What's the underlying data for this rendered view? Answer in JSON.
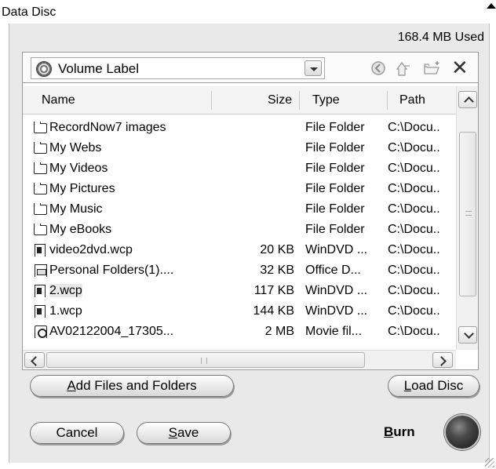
{
  "window": {
    "title": "Data Disc"
  },
  "disc": {
    "used": "168.4 MB Used"
  },
  "volume": {
    "label": "Volume Label"
  },
  "columns": {
    "name": "Name",
    "size": "Size",
    "type": "Type",
    "path": "Path"
  },
  "files": [
    {
      "name": "RecordNow7 images",
      "size": "",
      "type": "File Folder",
      "path": "C:\\Docu..",
      "icon": "folder-icon"
    },
    {
      "name": "My Webs",
      "size": "",
      "type": "File Folder",
      "path": "C:\\Docu..",
      "icon": "folder-icon"
    },
    {
      "name": "My Videos",
      "size": "",
      "type": "File Folder",
      "path": "C:\\Docu..",
      "icon": "folder-icon"
    },
    {
      "name": "My Pictures",
      "size": "",
      "type": "File Folder",
      "path": "C:\\Docu..",
      "icon": "folder-icon"
    },
    {
      "name": "My Music",
      "size": "",
      "type": "File Folder",
      "path": "C:\\Docu..",
      "icon": "folder-icon"
    },
    {
      "name": "My eBooks",
      "size": "",
      "type": "File Folder",
      "path": "C:\\Docu..",
      "icon": "folder-icon"
    },
    {
      "name": "video2dvd.wcp",
      "size": "20 KB",
      "type": "WinDVD ...",
      "path": "C:\\Docu..",
      "icon": "wcp-file-icon"
    },
    {
      "name": "Personal Folders(1)....",
      "size": "32 KB",
      "type": "Office D...",
      "path": "C:\\Docu..",
      "icon": "pst-file-icon"
    },
    {
      "name": "2.wcp",
      "size": "117 KB",
      "type": "WinDVD ...",
      "path": "C:\\Docu..",
      "icon": "wcp-file-icon"
    },
    {
      "name": "1.wcp",
      "size": "144 KB",
      "type": "WinDVD ...",
      "path": "C:\\Docu..",
      "icon": "wcp-file-icon"
    },
    {
      "name": "AV02122004_17305...",
      "size": "2 MB",
      "type": "Movie fil...",
      "path": "C:\\Docu..",
      "icon": "movie-file-icon"
    }
  ],
  "buttons": {
    "add_files": {
      "pre": "",
      "key": "A",
      "post": "dd Files and Folders"
    },
    "load_disc": {
      "pre": "",
      "key": "L",
      "post": "oad Disc"
    },
    "cancel": "Cancel",
    "save": {
      "pre": "",
      "key": "S",
      "post": "ave"
    },
    "burn": {
      "pre": "",
      "key": "B",
      "post": "urn"
    }
  }
}
